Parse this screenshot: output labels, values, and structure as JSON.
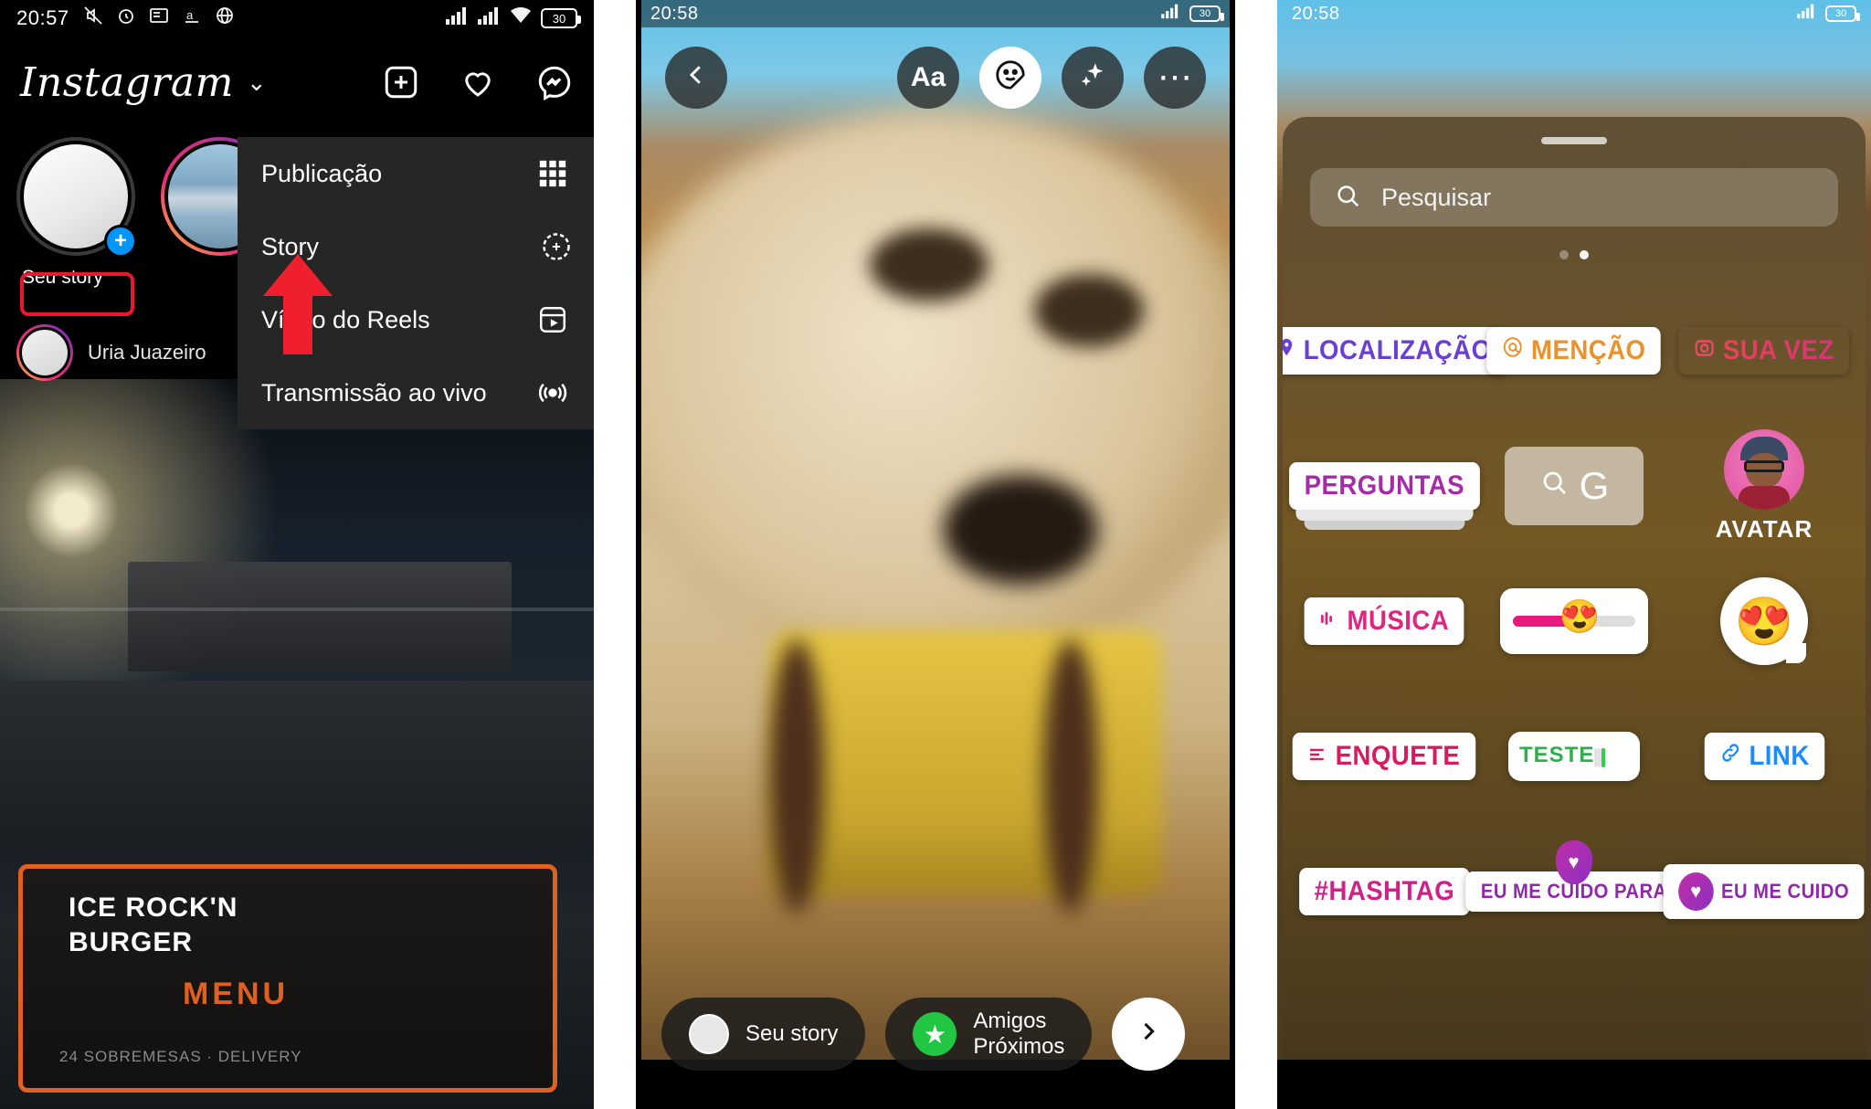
{
  "panel1": {
    "status": {
      "time": "20:57",
      "battery": "30",
      "left_icons": [
        "mute-icon",
        "alarm-icon",
        "news-icon",
        "translate-icon",
        "globe-icon"
      ],
      "right_icons": [
        "signal-1-icon",
        "signal-2-icon",
        "wifi-icon",
        "battery-icon"
      ]
    },
    "header": {
      "logo": "Instagram",
      "chevron": "chevron-down-icon",
      "icons": [
        "plus-square-icon",
        "heart-icon",
        "messenger-icon"
      ]
    },
    "stories": [
      {
        "label": "Seu story",
        "badge": "+"
      },
      {
        "label": "",
        "badge": ""
      }
    ],
    "highlight_label": "Seu story",
    "second_story": {
      "name": "Uria Juazeiro"
    },
    "menu": {
      "items": [
        {
          "label": "Publicação",
          "icon": "grid-icon"
        },
        {
          "label": "Story",
          "icon": "plus-circle-icon"
        },
        {
          "label": "Vídeo do Reels",
          "icon": "reels-icon"
        },
        {
          "label": "Transmissão ao vivo",
          "icon": "live-broadcast-icon"
        }
      ]
    },
    "feed_photo": {
      "sign_line1": "ICE ROCK'N",
      "sign_line2": "BURGER",
      "sign_line3": "MENU",
      "sign_line4": "24 SOBREMESAS · DELIVERY"
    }
  },
  "panel2": {
    "status": {
      "time": "20:58",
      "battery": "30"
    },
    "toolbar": {
      "back": "chevron-left-icon",
      "buttons": [
        {
          "label": "Aa",
          "name": "text-tool-button"
        },
        {
          "label": "",
          "name": "sticker-tool-button"
        },
        {
          "label": "",
          "name": "effects-tool-button"
        },
        {
          "label": "",
          "name": "more-options-button"
        }
      ]
    },
    "bottom": {
      "your_story": "Seu story",
      "close_friends_line1": "Amigos",
      "close_friends_line2": "Próximos",
      "next": "chevron-right-icon"
    }
  },
  "panel3": {
    "status": {
      "time": "20:58",
      "battery": "30"
    },
    "search": {
      "placeholder": "Pesquisar",
      "icon": "search-icon"
    },
    "pagination": {
      "total": 2,
      "active": 2
    },
    "stickers": [
      [
        {
          "label": "LOCALIZAÇÃO",
          "icon": "pin-icon",
          "color": "#6b3fd4",
          "type": "pill"
        },
        {
          "label": "MENÇÃO",
          "icon": "at-icon",
          "color": "#e8932c",
          "type": "pill"
        },
        {
          "label": "SUA VEZ",
          "icon": "camera-icon",
          "color": "#d6317f",
          "type": "pill"
        }
      ],
      [
        {
          "label": "PERGUNTAS",
          "icon": "",
          "color": "#a62ba8",
          "type": "stack"
        },
        {
          "label": "G",
          "icon": "search-icon",
          "color": "#ffffff",
          "type": "gif"
        },
        {
          "label": "AVATAR",
          "icon": "avatar-icon",
          "color": "#ffffff",
          "type": "avatar"
        }
      ],
      [
        {
          "label": "MÚSICA",
          "icon": "music-bars-icon",
          "color": "#e0257f",
          "type": "pill"
        },
        {
          "label": "",
          "icon": "emoji-slider-icon",
          "color": "#e8197d",
          "type": "slider"
        },
        {
          "label": "",
          "icon": "emoji-reaction-icon",
          "color": "#ffffff",
          "type": "emoji"
        }
      ],
      [
        {
          "label": "ENQUETE",
          "icon": "poll-icon",
          "color": "#d81b60",
          "type": "pill"
        },
        {
          "label": "TESTE",
          "icon": "",
          "color": "#2fae4e",
          "type": "quiz"
        },
        {
          "label": "LINK",
          "icon": "link-icon",
          "color": "#1a8cff",
          "type": "pill"
        }
      ],
      [
        {
          "label": "#HASHTAG",
          "icon": "",
          "color": "#d0208a",
          "type": "pill"
        },
        {
          "label": "EU ME CUIDO PARA",
          "icon": "heart-pin-icon",
          "color": "#8e2aa8",
          "type": "pill"
        },
        {
          "label": "EU ME CUIDO",
          "icon": "heart-badge-icon",
          "color": "#8e2aa8",
          "type": "pill"
        }
      ]
    ]
  }
}
